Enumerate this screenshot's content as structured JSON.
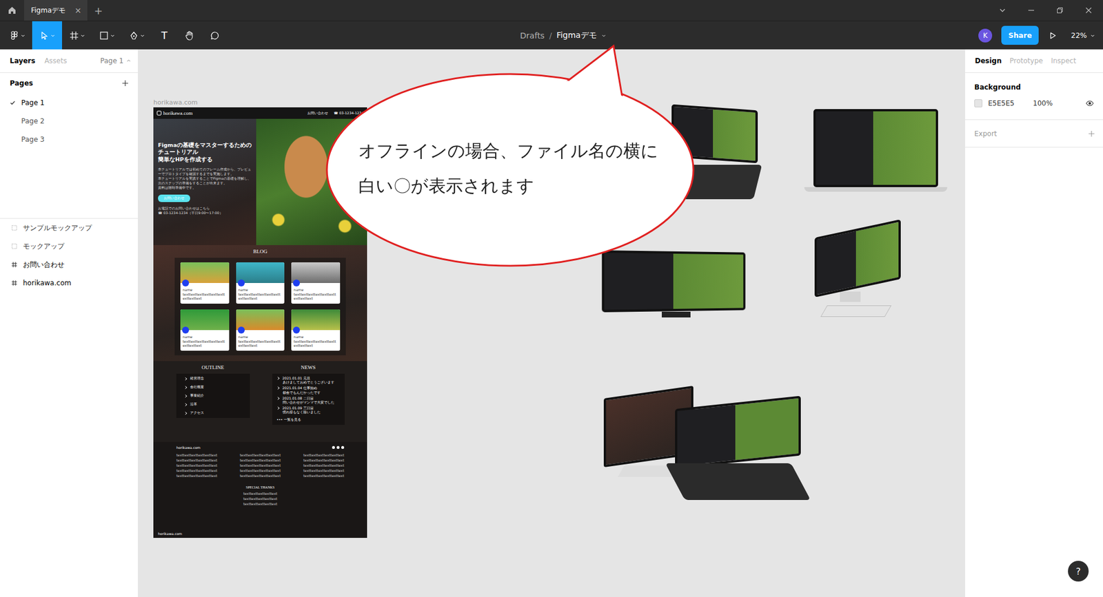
{
  "tabbar": {
    "tabs": [
      {
        "label": "Figmaデモ",
        "close": "×",
        "selected": true
      }
    ],
    "new_tab": "+"
  },
  "toolbar": {
    "tools": [
      {
        "kind": "menu",
        "selected": false,
        "dropdown": true
      },
      {
        "kind": "move",
        "selected": true,
        "dropdown": true
      },
      {
        "kind": "frame",
        "selected": false,
        "dropdown": true
      },
      {
        "kind": "shape",
        "selected": false,
        "dropdown": true
      },
      {
        "kind": "pen",
        "selected": false,
        "dropdown": true
      },
      {
        "kind": "text",
        "glyph": "T",
        "selected": false,
        "dropdown": false
      },
      {
        "kind": "hand",
        "selected": false,
        "dropdown": false
      },
      {
        "kind": "comment",
        "selected": false,
        "dropdown": false
      }
    ],
    "breadcrumb": {
      "folder": "Drafts",
      "separator": "/",
      "file": "Figmaデモ"
    },
    "avatar": "K",
    "share": "Share",
    "zoom": "22%"
  },
  "left_panel": {
    "tabs": [
      {
        "label": "Layers",
        "selected": true
      },
      {
        "label": "Assets",
        "selected": false
      }
    ],
    "page_picker": "Page 1",
    "pages_title": "Pages",
    "pages": [
      {
        "label": "Page 1",
        "selected": true
      },
      {
        "label": "Page 2",
        "selected": false
      },
      {
        "label": "Page 3",
        "selected": false
      }
    ],
    "layers": [
      {
        "label": "サンプルモックアップ",
        "kind": "group"
      },
      {
        "label": "モックアップ",
        "kind": "group"
      },
      {
        "label": "お問い合わせ",
        "kind": "frame"
      },
      {
        "label": "horikawa.com",
        "kind": "frame"
      }
    ]
  },
  "right_panel": {
    "tabs": [
      {
        "label": "Design",
        "selected": true
      },
      {
        "label": "Prototype",
        "selected": false
      },
      {
        "label": "Inspect",
        "selected": false
      }
    ],
    "background": {
      "title": "Background",
      "hex": "E5E5E5",
      "opacity": "100%",
      "visible": true
    },
    "export": {
      "title": "Export"
    }
  },
  "canvas": {
    "frame_label": "horikawa.com",
    "site": {
      "logo": "horikawa.com",
      "nav": [
        "お問い合わせ",
        "☎ 03-1234-1234"
      ],
      "hero": {
        "title": [
          "Figmaの基礎をマスターするための",
          "チュートリアル",
          "簡単なHPを作成する"
        ],
        "body": [
          "本チュートリアルでは初めてのフレーム作成から、プレビューでプロトタイプを確認するまでを実施します。",
          "本チュートリアルを実践することでFigmaの基礎を理解し、次のステップの準備をすることが出来ます。",
          "資料は随時準備中です。"
        ],
        "button": "お問い合わせ",
        "contact": [
          "お電話でのお問い合わせはこちら",
          "☎ 03-1234-1234（平日9:00〜17:00）"
        ]
      },
      "blog": {
        "title": "BLOG",
        "cards": [
          {
            "name": "name",
            "text": "texttexttexttexttexttexttexttexttext"
          },
          {
            "name": "name",
            "text": "texttexttexttexttexttexttexttexttext"
          },
          {
            "name": "name",
            "text": "texttexttexttexttexttexttexttexttext"
          },
          {
            "name": "name",
            "text": "texttexttexttexttexttexttexttexttext"
          },
          {
            "name": "name",
            "text": "texttexttexttexttexttexttexttexttext"
          },
          {
            "name": "name",
            "text": "texttexttexttexttexttexttexttexttext"
          }
        ]
      },
      "outline": {
        "title": "OUTLINE",
        "items": [
          "経営理念",
          "会社概要",
          "事業紹介",
          "沿革",
          "アクセス"
        ]
      },
      "news": {
        "title": "NEWS",
        "items": [
          {
            "date": "2021.01.01",
            "tag": "元旦",
            "text": "あけましておめでとうございます"
          },
          {
            "date": "2021.01.04",
            "tag": "仕事始め",
            "text": "都会でもんだかったです"
          },
          {
            "date": "2021.01.08",
            "tag": "二日目",
            "text": "問い合わせがマンマで大変でした"
          },
          {
            "date": "2021.01.09",
            "tag": "三日目",
            "text": "慣れ様もなく除いました"
          }
        ],
        "more_icon": "•••",
        "more": "一覧を見る"
      },
      "footer": {
        "logo": "horikawa.com",
        "columns": [
          [
            "texttexttexttexttexttext",
            "texttexttexttexttexttext",
            "texttexttexttexttexttext",
            "texttexttexttexttexttext",
            "texttexttexttexttexttext"
          ],
          [
            "texttexttexttexttexttext",
            "texttexttexttexttexttext",
            "texttexttexttexttexttext",
            "texttexttexttexttexttext",
            "texttexttexttexttexttext"
          ],
          [
            "texttexttexttexttexttext",
            "texttexttexttexttexttext",
            "texttexttexttexttexttext",
            "texttexttexttexttexttext",
            "texttexttexttexttexttext"
          ]
        ],
        "thanks_title": "SPECIAL THANKS",
        "thanks": [
          "texttexttexttexttext",
          "texttexttexttexttext",
          "texttexttexttexttext"
        ],
        "bottom_logo": "horikawa.com"
      }
    }
  },
  "callout": {
    "lines": [
      "オフラインの場合、ファイル名の横に",
      "白い〇が表示されます"
    ]
  },
  "help": "?"
}
